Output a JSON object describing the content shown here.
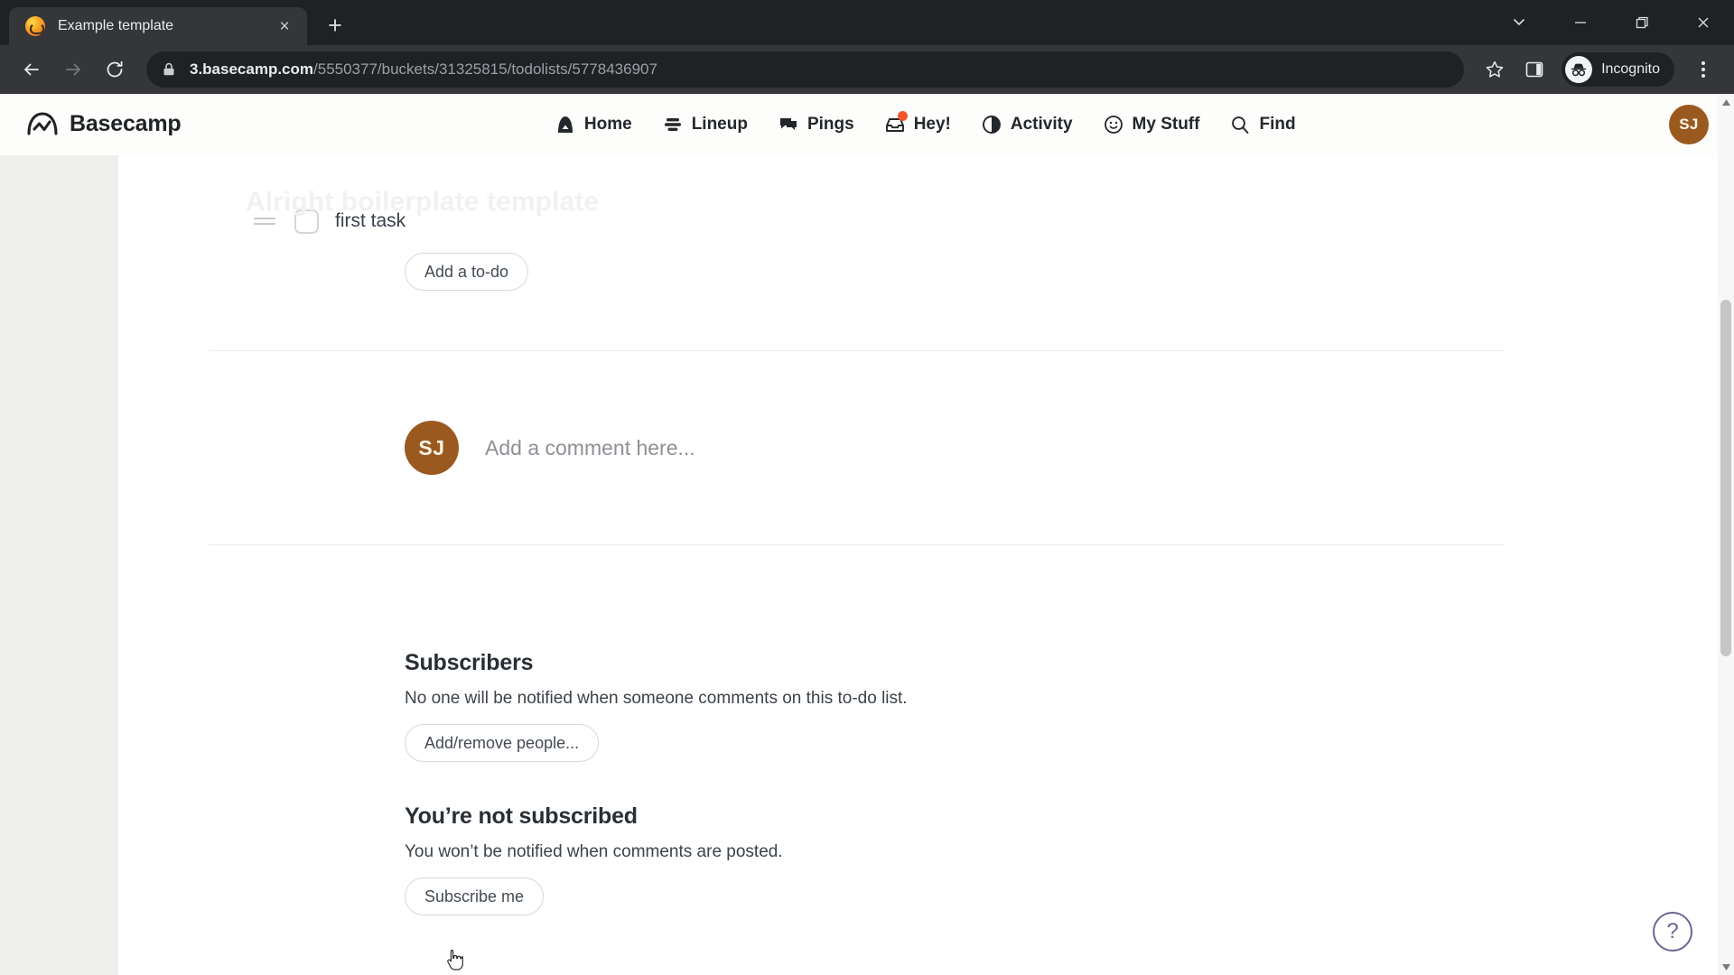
{
  "browser": {
    "tab": {
      "title": "Example template",
      "favicon": "basecamp-favicon",
      "close_label": "×"
    },
    "newtab_label": "+",
    "window_controls": {
      "minimize_group": "⌄",
      "minimize": "—",
      "maximize": "❐",
      "close": "✕"
    },
    "toolbar": {
      "back": "←",
      "forward": "→",
      "reload": "↻",
      "url_domain": "3.basecamp.com",
      "url_path": "/5550377/buckets/31325815/todolists/5778436907",
      "url_full": "3.basecamp.com/5550377/buckets/31325815/todolists/5778436907",
      "bookmark": "☆",
      "incognito_label": "Incognito",
      "menu": "kebab-menu"
    }
  },
  "app": {
    "logo_text": "Basecamp",
    "ghost_title": "Alright boilerplate template",
    "nav": [
      {
        "label": "Home",
        "icon": "home-icon",
        "badge": false
      },
      {
        "label": "Lineup",
        "icon": "lineup-icon",
        "badge": false
      },
      {
        "label": "Pings",
        "icon": "pings-icon",
        "badge": false
      },
      {
        "label": "Hey!",
        "icon": "hey-inbox-icon",
        "badge": true
      },
      {
        "label": "Activity",
        "icon": "activity-icon",
        "badge": false
      },
      {
        "label": "My Stuff",
        "icon": "smiley-icon",
        "badge": false
      },
      {
        "label": "Find",
        "icon": "search-icon",
        "badge": false
      }
    ],
    "avatar_initials": "SJ",
    "avatar_color": "#9a5a1f",
    "badge_color": "#f4552b"
  },
  "main": {
    "todos": [
      {
        "text": "first task",
        "checked": false
      }
    ],
    "add_todo_label": "Add a to-do",
    "comment": {
      "avatar_initials": "SJ",
      "placeholder": "Add a comment here..."
    },
    "subscribers": {
      "title": "Subscribers",
      "description": "No one will be notified when someone comments on this to-do list.",
      "button_label": "Add/remove people..."
    },
    "subscription": {
      "title": "You’re not subscribed",
      "description": "You won’t be notified when comments are posted.",
      "button_label": "Subscribe me"
    }
  },
  "overlays": {
    "help_label": "?",
    "help_color": "#6f6394"
  }
}
